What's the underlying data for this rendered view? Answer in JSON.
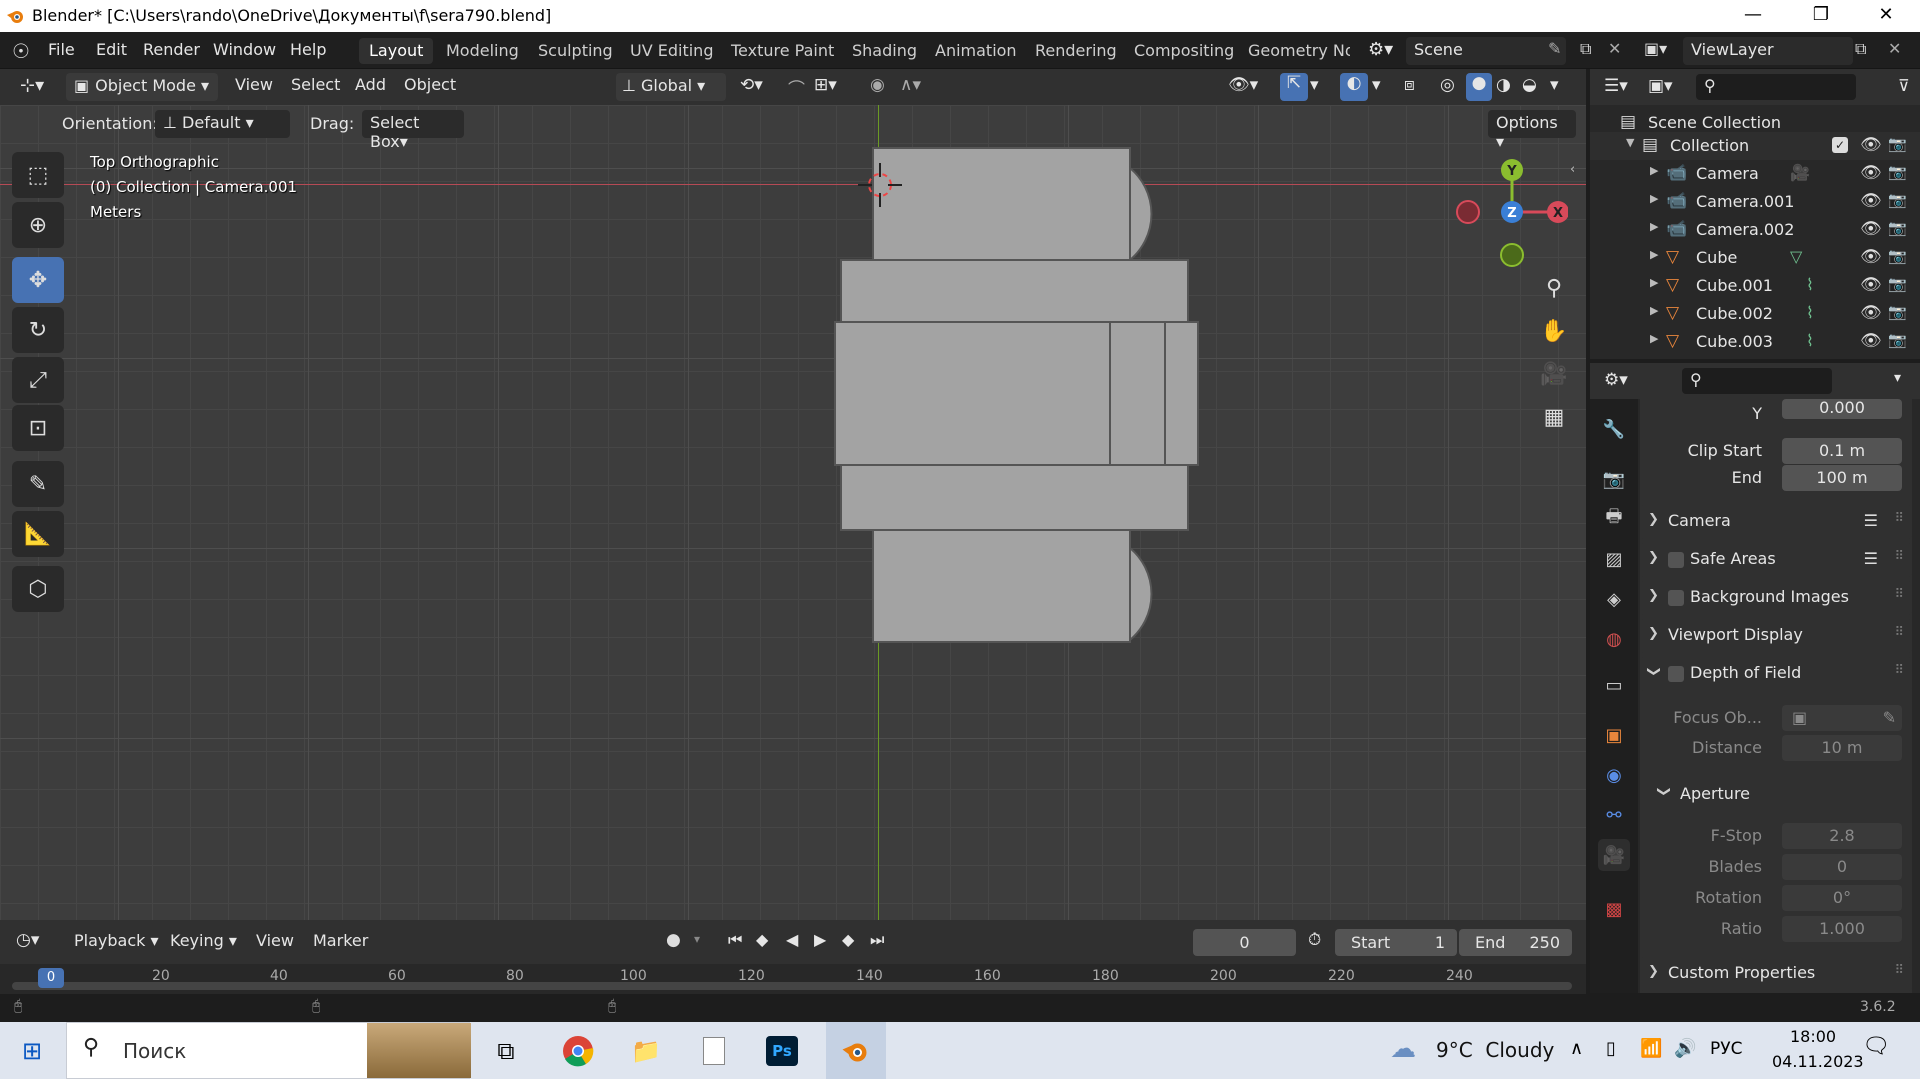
{
  "title_bar": {
    "title": "Blender* [C:\\Users\\rando\\OneDrive\\Документы\\f\\sera790.blend]",
    "minimize": "—",
    "maximize": "❐",
    "close": "✕"
  },
  "menu": [
    "File",
    "Edit",
    "Render",
    "Window",
    "Help"
  ],
  "workspace_tabs": [
    "Layout",
    "Modeling",
    "Sculpting",
    "UV Editing",
    "Texture Paint",
    "Shading",
    "Animation",
    "Rendering",
    "Compositing",
    "Geometry Noc"
  ],
  "active_workspace": "Layout",
  "scene": {
    "label": "Scene"
  },
  "view_layer": {
    "label": "ViewLayer"
  },
  "viewport_header": {
    "mode": "Object Mode",
    "menus": [
      "View",
      "Select",
      "Add",
      "Object"
    ],
    "transform_orientation": "Global"
  },
  "tool_options": {
    "orientation_label": "Orientation:",
    "orientation_value": "Default",
    "drag_label": "Drag:",
    "drag_value": "Select Box",
    "options_label": "Options"
  },
  "viewport_overlay": {
    "view_name": "Top Orthographic",
    "collection_line": "(0) Collection | Camera.001",
    "units": "Meters"
  },
  "gizmo": {
    "y": "Y",
    "z": "Z",
    "x": "X"
  },
  "colors": {
    "accent": "#4772b3",
    "x_axis": "#d84a5a",
    "y_axis": "#8bbd2f",
    "z_axis": "#3a7fd6",
    "object_gray": "#a0a0a0",
    "camera_orange": "#e9863c"
  },
  "outliner": {
    "root": "Scene Collection",
    "collection": "Collection",
    "items": [
      {
        "name": "Camera",
        "icon": "camera-object-icon",
        "extra": "camera-data-icon"
      },
      {
        "name": "Camera.001",
        "icon": "camera-object-icon"
      },
      {
        "name": "Camera.002",
        "icon": "camera-object-icon"
      },
      {
        "name": "Cube",
        "icon": "mesh-object-icon",
        "extra": "mesh-data-icon"
      },
      {
        "name": "Cube.001",
        "icon": "mesh-object-icon",
        "extra": "modifier-icon"
      },
      {
        "name": "Cube.002",
        "icon": "mesh-object-icon",
        "extra": "modifier-icon"
      },
      {
        "name": "Cube.003",
        "icon": "mesh-object-icon",
        "extra": "modifier-icon"
      }
    ]
  },
  "properties": {
    "y_label": "Y",
    "y_value": "0.000",
    "clip_start_label": "Clip Start",
    "clip_start_value": "0.1 m",
    "clip_end_label": "End",
    "clip_end_value": "100 m",
    "panels": {
      "camera": "Camera",
      "safe_areas": "Safe Areas",
      "background_images": "Background Images",
      "viewport_display": "Viewport Display",
      "depth_of_field": "Depth of Field",
      "custom_properties": "Custom Properties"
    },
    "dof": {
      "focus_object_label": "Focus Ob...",
      "distance_label": "Distance",
      "distance_value": "10 m",
      "aperture_label": "Aperture",
      "fstop_label": "F-Stop",
      "fstop_value": "2.8",
      "blades_label": "Blades",
      "blades_value": "0",
      "rotation_label": "Rotation",
      "rotation_value": "0°",
      "ratio_label": "Ratio",
      "ratio_value": "1.000"
    }
  },
  "timeline": {
    "menus": [
      "Playback",
      "Keying",
      "View",
      "Marker"
    ],
    "current_frame": "0",
    "start_label": "Start",
    "start_value": "1",
    "end_label": "End",
    "end_value": "250",
    "ruler": [
      "0",
      "20",
      "40",
      "60",
      "80",
      "100",
      "120",
      "140",
      "160",
      "180",
      "200",
      "220",
      "240"
    ]
  },
  "status_bar": {
    "version": "3.6.2"
  },
  "taskbar": {
    "search_placeholder": "Поиск",
    "weather": "9°C  Cloudy",
    "language": "РУС",
    "time": "18:00",
    "date": "04.11.2023"
  }
}
